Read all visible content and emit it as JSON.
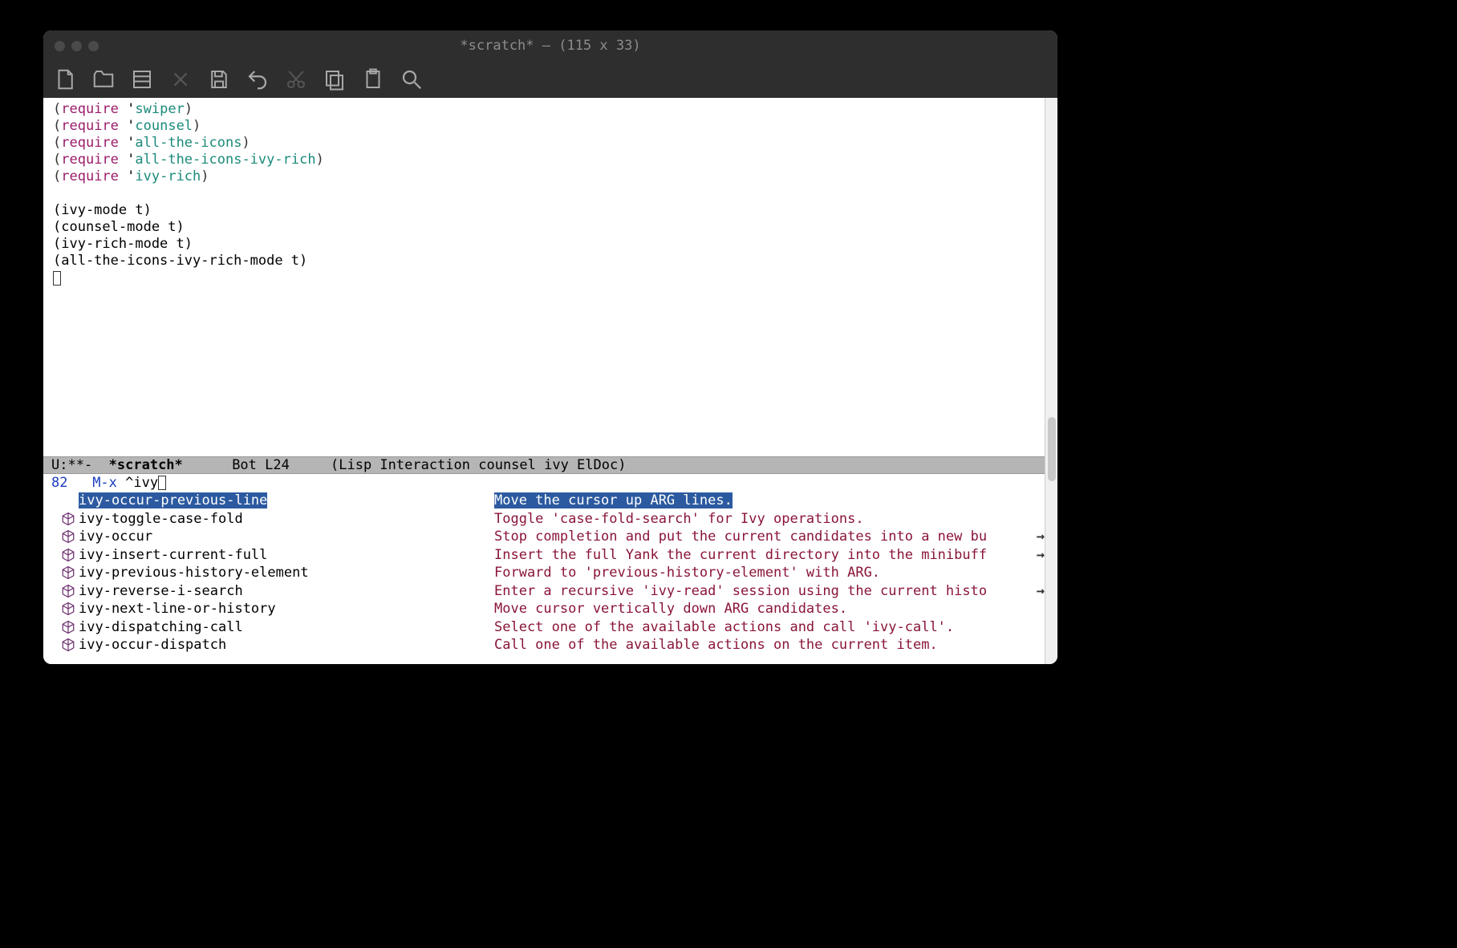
{
  "title": "*scratch*  —  (115 x 33)",
  "code": {
    "l1": {
      "kw": "require",
      "str": "swiper"
    },
    "l2": {
      "kw": "require",
      "str": "counsel"
    },
    "l3": {
      "kw": "require",
      "str": "all-the-icons"
    },
    "l4": {
      "kw": "require",
      "str": "all-the-icons-ivy-rich"
    },
    "l5": {
      "kw": "require",
      "str": "ivy-rich"
    },
    "l7": "(ivy-mode t)",
    "l8": "(counsel-mode t)",
    "l9": "(ivy-rich-mode t)",
    "l10": "(all-the-icons-ivy-rich-mode t)"
  },
  "modeline": {
    "left": "U:**-  ",
    "buf": "*scratch*",
    "pos": "      Bot L24     ",
    "mode": "(Lisp Interaction counsel ivy ElDoc)"
  },
  "minibuffer": {
    "count": "82   ",
    "prompt": "M-x ",
    "input": "^ivy"
  },
  "candidates": [
    {
      "name": "ivy-occur-previous-line",
      "desc": "Move the cursor up ARG lines.",
      "selected": true
    },
    {
      "name": "ivy-toggle-case-fold",
      "desc": "Toggle 'case-fold-search' for Ivy operations."
    },
    {
      "name": "ivy-occur",
      "desc": "Stop completion and put the current candidates into a new bu",
      "overflow": true
    },
    {
      "name": "ivy-insert-current-full",
      "desc": "Insert the full Yank the current directory into the minibuff",
      "overflow": true
    },
    {
      "name": "ivy-previous-history-element",
      "desc": "Forward to 'previous-history-element' with ARG."
    },
    {
      "name": "ivy-reverse-i-search",
      "desc": "Enter a recursive 'ivy-read' session using the current histo",
      "overflow": true
    },
    {
      "name": "ivy-next-line-or-history",
      "desc": "Move cursor vertically down ARG candidates."
    },
    {
      "name": "ivy-dispatching-call",
      "desc": "Select one of the available actions and call 'ivy-call'."
    },
    {
      "name": "ivy-occur-dispatch",
      "desc": "Call one of the available actions on the current item."
    }
  ]
}
